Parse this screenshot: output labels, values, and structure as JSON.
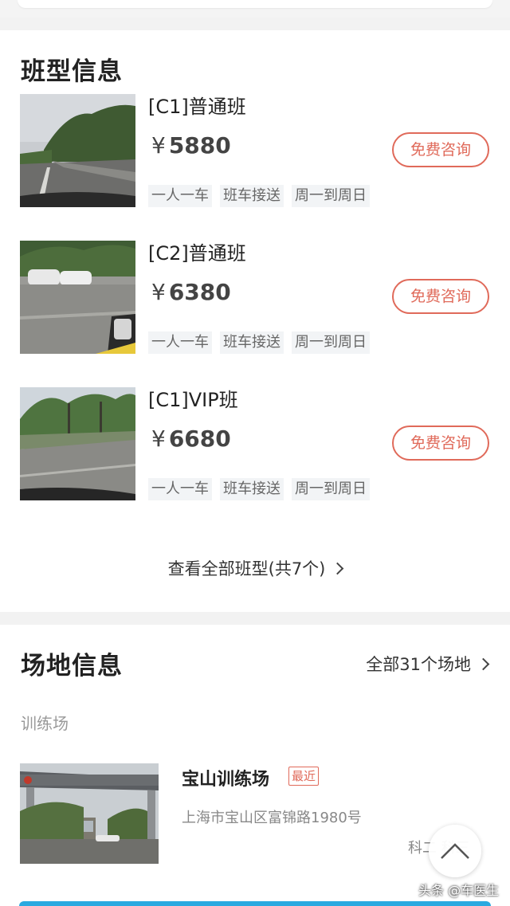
{
  "courses_section": {
    "title": "班型信息",
    "courses": [
      {
        "name": "[C1]普通班",
        "currency": "¥",
        "price": "5880",
        "button": "免费咨询",
        "tags": [
          "一人一车",
          "班车接送",
          "周一到周日"
        ]
      },
      {
        "name": "[C2]普通班",
        "currency": "¥",
        "price": "6380",
        "button": "免费咨询",
        "tags": [
          "一人一车",
          "班车接送",
          "周一到周日"
        ]
      },
      {
        "name": "[C1]VIP班",
        "currency": "¥",
        "price": "6680",
        "button": "免费咨询",
        "tags": [
          "一人一车",
          "班车接送",
          "周一到周日"
        ]
      }
    ],
    "view_all": "查看全部班型(共7个)"
  },
  "venues_section": {
    "title": "场地信息",
    "all_link": "全部31个场地",
    "sub_label": "训练场",
    "venue": {
      "name": "宝山训练场",
      "badge": "最近",
      "address": "上海市宝山区富锦路1980号",
      "subject_partial": "科二 科三"
    }
  },
  "watermark": "头条 @车医生",
  "colors": {
    "accent": "#e06a5a",
    "bar": "#2aa9e0"
  }
}
